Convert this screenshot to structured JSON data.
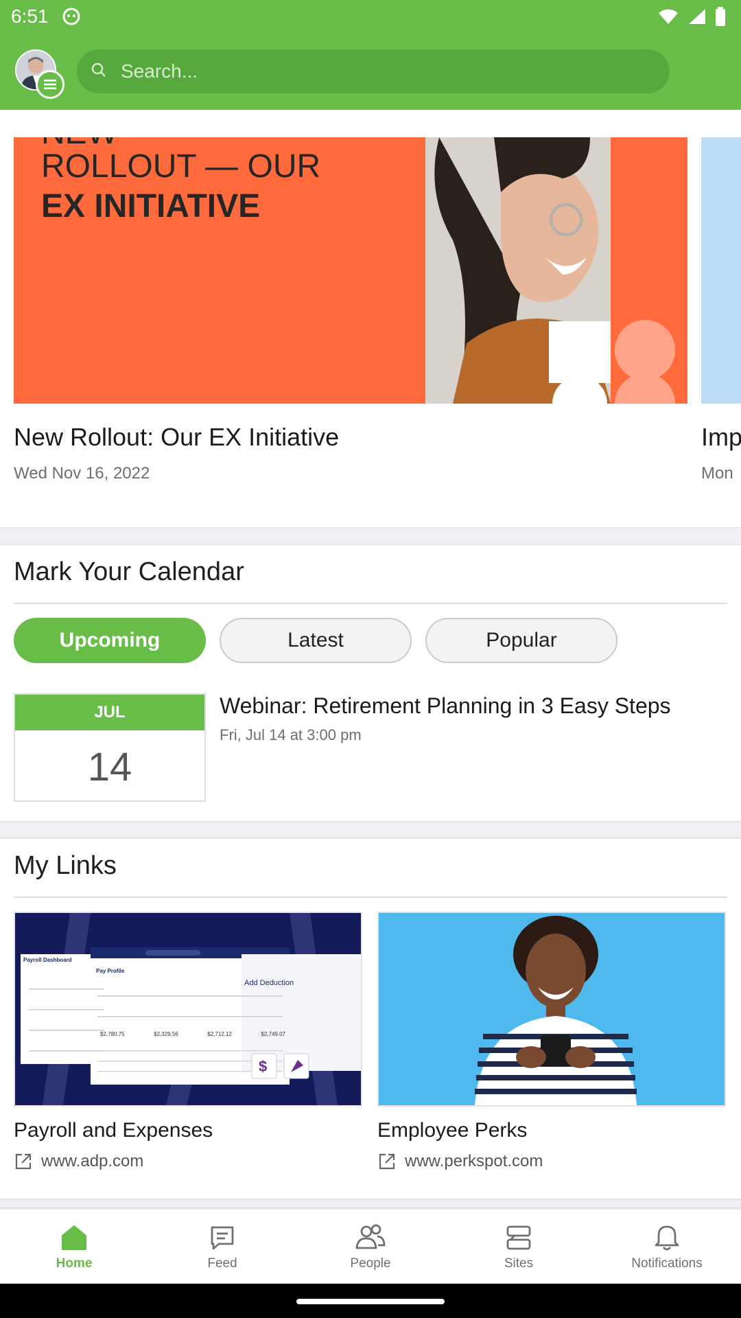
{
  "status_bar": {
    "time": "6:51"
  },
  "search": {
    "placeholder": "Search..."
  },
  "carousel": {
    "cards": [
      {
        "title": "New Rollout: Our EX Initiative",
        "date": "Wed Nov 16, 2022",
        "hero_line1": "NEW",
        "hero_line2": "ROLLOUT — OUR",
        "hero_line3": "EX INITIATIVE"
      },
      {
        "title": "Imp",
        "date": "Mon"
      }
    ]
  },
  "calendar": {
    "title": "Mark Your Calendar",
    "filters": [
      "Upcoming",
      "Latest",
      "Popular"
    ],
    "event": {
      "month": "JUL",
      "day": "14",
      "title": "Webinar: Retirement Planning in 3 Easy Steps",
      "time": "Fri, Jul 14 at 3:00 pm"
    }
  },
  "links": {
    "title": "My Links",
    "items": [
      {
        "title": "Payroll and Expenses",
        "url": "www.adp.com",
        "thumb_heading": "Payroll Dashboard",
        "thumb_sub": "Pay Profile",
        "thumb_deduction": "Add Deduction",
        "thumb_amounts": [
          "$2,780.75",
          "$2,329.56",
          "$2,712.12",
          "$2,749.07"
        ]
      },
      {
        "title": "Employee Perks",
        "url": "www.perkspot.com"
      }
    ]
  },
  "bottom_nav": [
    {
      "label": "Home",
      "icon": "home-icon"
    },
    {
      "label": "Feed",
      "icon": "chat-icon"
    },
    {
      "label": "People",
      "icon": "people-icon"
    },
    {
      "label": "Sites",
      "icon": "sites-icon"
    },
    {
      "label": "Notifications",
      "icon": "bell-icon"
    }
  ],
  "colors": {
    "accent": "#67bd47",
    "hero_orange": "#ff6b3d",
    "adp_navy": "#141b5a",
    "perks_blue": "#4fb8ec"
  }
}
